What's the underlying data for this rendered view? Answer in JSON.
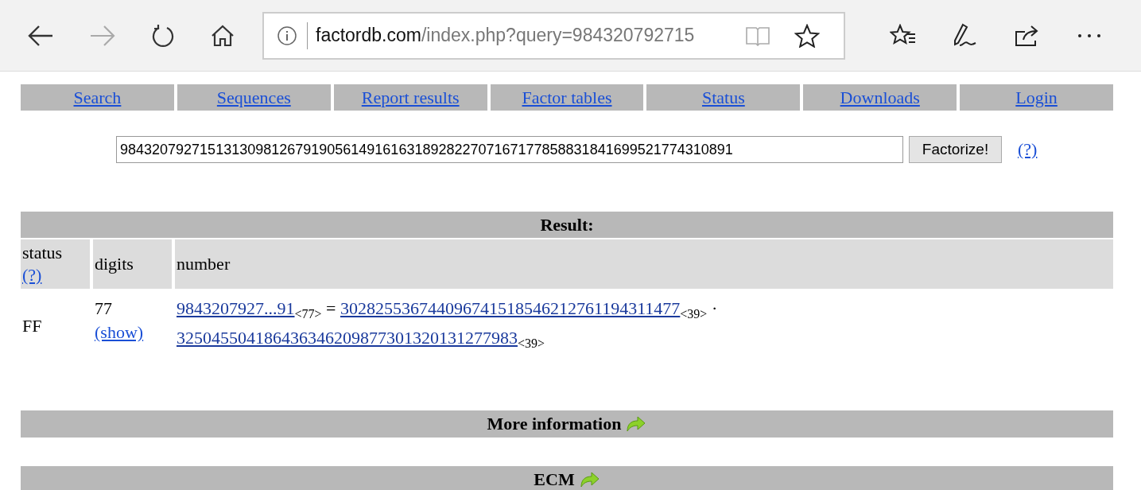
{
  "browser": {
    "url_domain": "factordb.com",
    "url_path": "/index.php?query=984320792715",
    "forward_disabled": true
  },
  "nav": [
    {
      "label": "Search"
    },
    {
      "label": "Sequences"
    },
    {
      "label": "Report results"
    },
    {
      "label": "Factor tables"
    },
    {
      "label": "Status"
    },
    {
      "label": "Downloads"
    },
    {
      "label": "Login"
    }
  ],
  "query": {
    "value": "98432079271513130981267919056149161631892822707167177858831841699521774310891",
    "button": "Factorize!",
    "help": "(?)"
  },
  "result": {
    "title": "Result:",
    "columns": [
      {
        "label": "status",
        "help": "(?)"
      },
      {
        "label": "digits"
      },
      {
        "label": "number"
      }
    ],
    "rows": [
      {
        "status": "FF",
        "digits": "77",
        "show": "(show)",
        "parts": [
          {
            "kind": "link",
            "text": "9843207927...91"
          },
          {
            "kind": "size",
            "text": "<77>"
          },
          {
            "kind": "op",
            "text": "="
          },
          {
            "kind": "link",
            "text": "302825536744096741518546212761194311477"
          },
          {
            "kind": "size",
            "text": "<39>"
          },
          {
            "kind": "op",
            "text": "·"
          },
          {
            "kind": "link",
            "text": "325045504186436346209877301320131277983"
          },
          {
            "kind": "size",
            "text": "<39>"
          }
        ]
      }
    ]
  },
  "sections": [
    {
      "title": "More information"
    },
    {
      "title": "ECM"
    }
  ]
}
